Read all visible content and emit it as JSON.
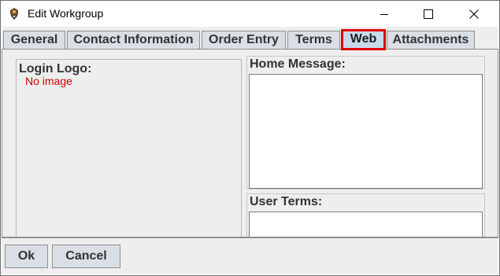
{
  "window": {
    "title": "Edit Workgroup",
    "controls": [
      "minimize-icon",
      "maximize-icon",
      "close-icon"
    ]
  },
  "tabs": [
    {
      "label": "General",
      "selected": false
    },
    {
      "label": "Contact Information",
      "selected": false
    },
    {
      "label": "Order Entry",
      "selected": false
    },
    {
      "label": "Terms",
      "selected": false
    },
    {
      "label": "Web",
      "selected": true
    },
    {
      "label": "Attachments",
      "selected": false
    }
  ],
  "web_panel": {
    "login_logo_label": "Login Logo:",
    "no_image_text": "No image",
    "home_message_label": "Home Message:",
    "home_message_value": "",
    "user_terms_label": "User Terms:",
    "user_terms_value": ""
  },
  "buttons": {
    "ok_label": "Ok",
    "cancel_label": "Cancel"
  },
  "colors": {
    "tab_background": "#dadfe6",
    "selected_tab_background": "#c9d8ea",
    "highlight_border": "#e00000",
    "no_image_text": "#cc0000",
    "panel_background": "#eeeeee"
  }
}
